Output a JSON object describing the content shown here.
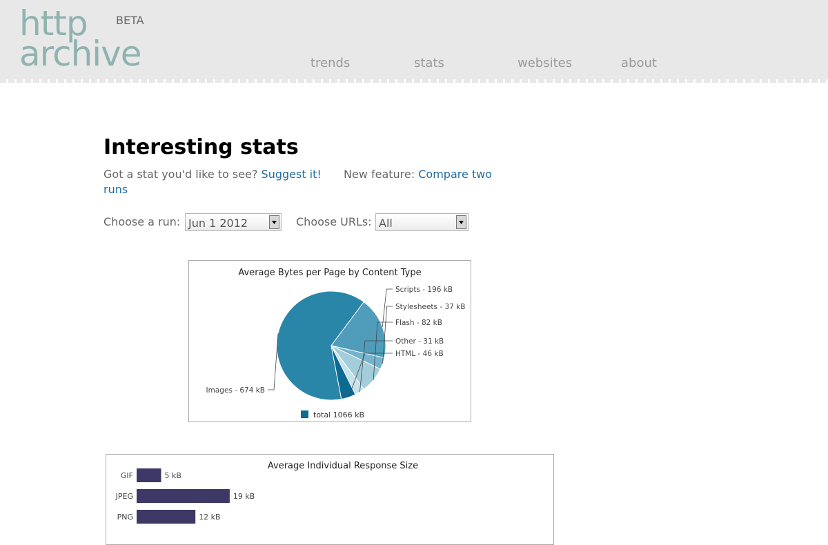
{
  "header": {
    "logo_line1": "http",
    "logo_line2": "archive",
    "beta": "BETA",
    "nav": [
      {
        "label": "trends"
      },
      {
        "label": "stats"
      },
      {
        "label": "websites"
      },
      {
        "label": "about"
      }
    ]
  },
  "page": {
    "title": "Interesting stats",
    "suggest_prompt": "Got a stat you'd like to see?",
    "suggest_link": "Suggest it!",
    "feature_prompt": "New feature:",
    "feature_link": "Compare two runs"
  },
  "controls": {
    "run_label": "Choose a run:",
    "run_value": "Jun 1 2012",
    "urls_label": "Choose URLs:",
    "urls_value": "All"
  },
  "colors": {
    "accent_link": "#1f6ba3",
    "logo": "#8fb3b0",
    "pie_images": "#2a86a8",
    "pie_scripts": "#4f9dbb",
    "pie_stylesheets": "#74b3cb",
    "pie_flash": "#a3cddb",
    "pie_other": "#c6e2ea",
    "pie_html": "#0d6a92",
    "bars": "#3d3866"
  },
  "chart_data": [
    {
      "type": "pie",
      "title": "Average Bytes per Page by Content Type",
      "slices": [
        {
          "label": "Images - 674 kB",
          "value": 674
        },
        {
          "label": "Scripts - 196 kB",
          "value": 196
        },
        {
          "label": "Stylesheets - 37 kB",
          "value": 37
        },
        {
          "label": "Flash - 82 kB",
          "value": 82
        },
        {
          "label": "Other - 31 kB",
          "value": 31
        },
        {
          "label": "HTML - 46 kB",
          "value": 46
        }
      ],
      "legend": "total 1066 kB",
      "legend_position": "bottom"
    },
    {
      "type": "bar",
      "orientation": "horizontal",
      "title": "Average Individual Response Size",
      "categories": [
        "GIF",
        "JPEG",
        "PNG"
      ],
      "values": [
        5,
        19,
        12
      ],
      "value_labels": [
        "5 kB",
        "19 kB",
        "12 kB"
      ],
      "unit": "kB"
    }
  ]
}
